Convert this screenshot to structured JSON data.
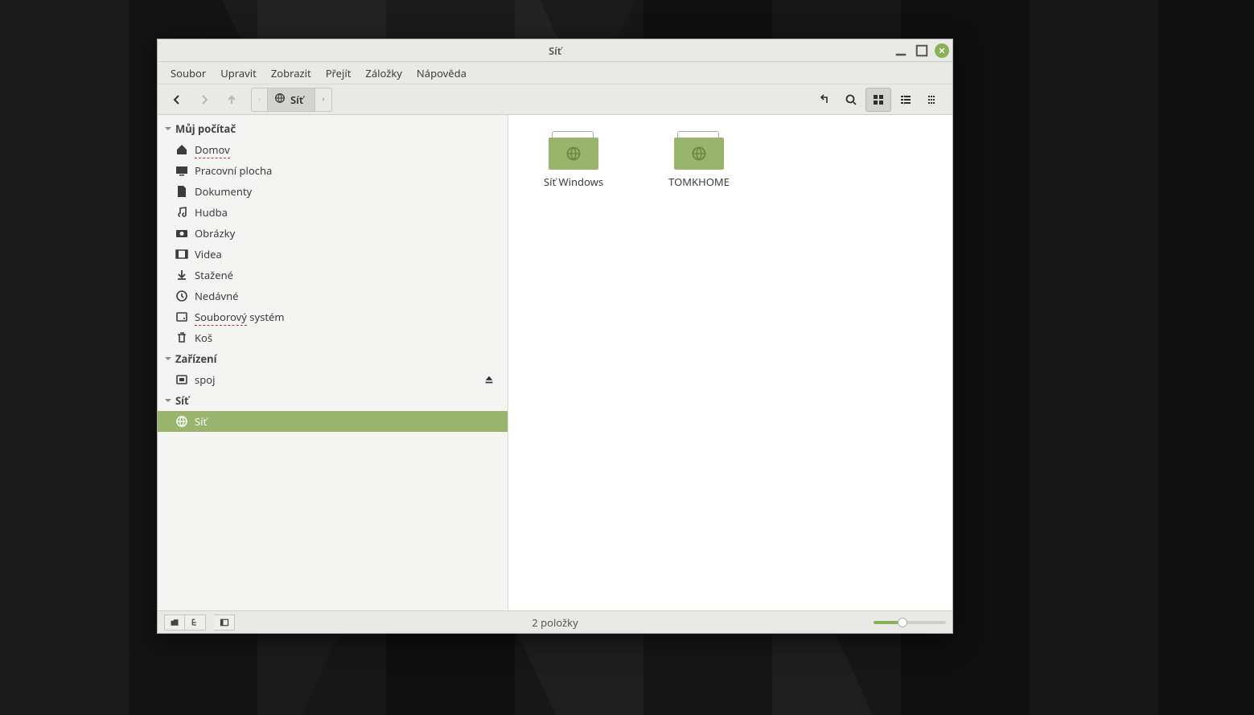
{
  "window": {
    "title": "Síť"
  },
  "menubar": [
    "Soubor",
    "Upravit",
    "Zobrazit",
    "Přejít",
    "Záložky",
    "Nápověda"
  ],
  "pathbar": {
    "current": "Síť"
  },
  "sidebar": {
    "groups": [
      {
        "label": "Můj počítač",
        "items": [
          {
            "icon": "home",
            "label": "Domov",
            "underline": true
          },
          {
            "icon": "desktop",
            "label": "Pracovní plocha"
          },
          {
            "icon": "doc",
            "label": "Dokumenty"
          },
          {
            "icon": "music",
            "label": "Hudba"
          },
          {
            "icon": "photo",
            "label": "Obrázky"
          },
          {
            "icon": "video",
            "label": "Videa"
          },
          {
            "icon": "down",
            "label": "Stažené"
          },
          {
            "icon": "recent",
            "label": "Nedávné"
          },
          {
            "icon": "disk",
            "label": "Souborový systém",
            "underline_end": 9
          },
          {
            "icon": "trash",
            "label": "Koš"
          }
        ]
      },
      {
        "label": "Zařízení",
        "items": [
          {
            "icon": "ext",
            "label": "spoj",
            "eject": true
          }
        ]
      },
      {
        "label": "Síť",
        "items": [
          {
            "icon": "globe",
            "label": "Síť",
            "selected": true
          }
        ]
      }
    ]
  },
  "content": {
    "items": [
      {
        "label": "Síť Windows"
      },
      {
        "label": "TOMKHOME"
      }
    ]
  },
  "statusbar": {
    "text": "2 položky"
  }
}
